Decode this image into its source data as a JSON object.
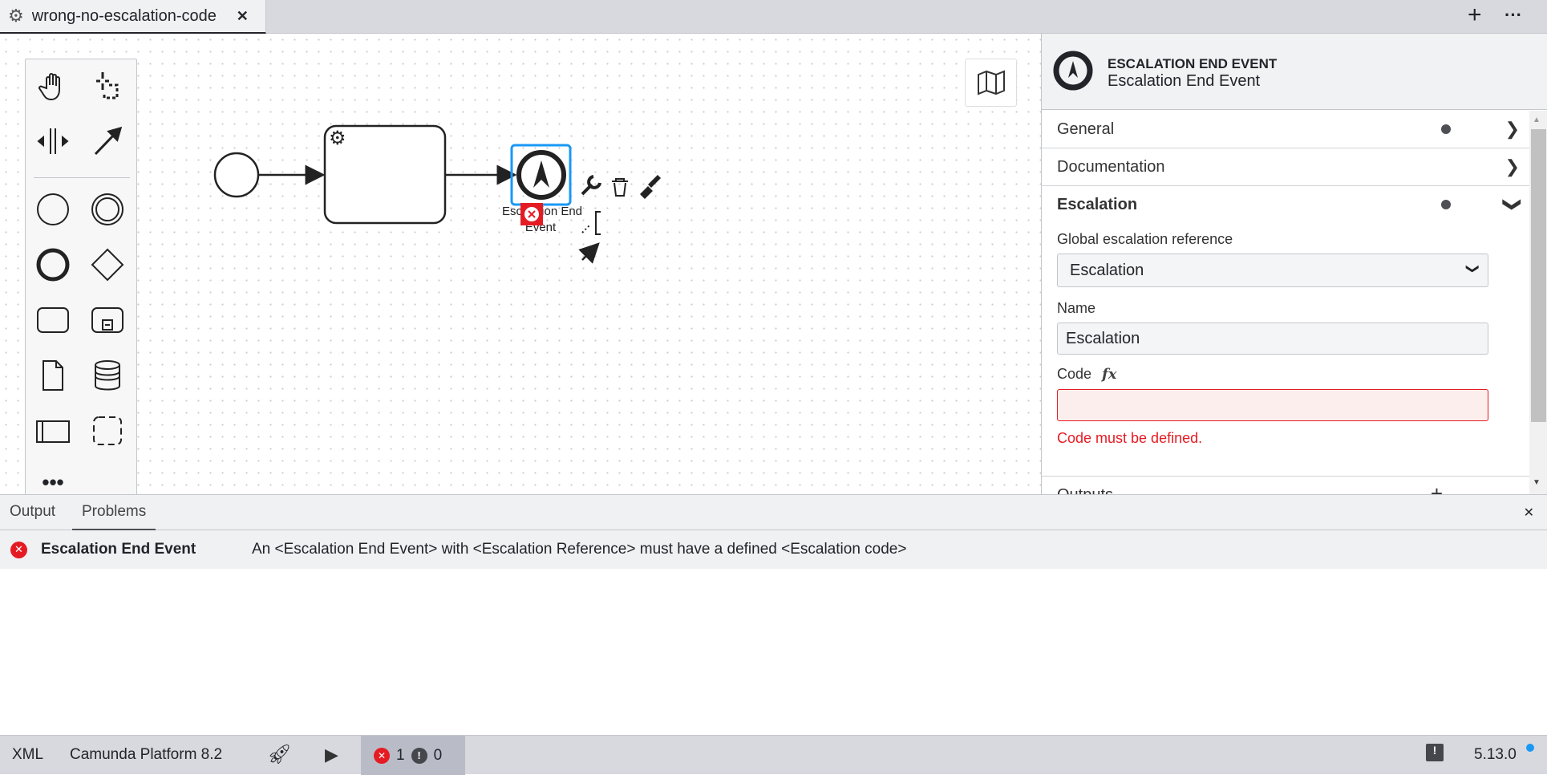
{
  "tab": {
    "title": "wrong-no-escalation-code",
    "icon": "gear-icon",
    "close": "✕"
  },
  "tabbar": {
    "add": "+",
    "more": "···"
  },
  "diagram": {
    "end_event_label_line1": "Escalation End",
    "end_event_label_line2": "Event",
    "selection_color": "#1a98f5",
    "error_color": "#e51b24"
  },
  "properties": {
    "type": "ESCALATION END EVENT",
    "name": "Escalation End Event",
    "sections": [
      {
        "label": "General",
        "has_dot": true
      },
      {
        "label": "Documentation",
        "has_dot": false
      },
      {
        "label": "Escalation",
        "has_dot": true,
        "expanded": true
      },
      {
        "label": "Outputs"
      }
    ],
    "global_ref_label": "Global escalation reference",
    "global_ref_value": "Escalation",
    "name_label": "Name",
    "name_value": "Escalation",
    "code_label": "Code",
    "code_fx": "fx",
    "code_value": "",
    "code_error": "Code must be defined."
  },
  "bottom": {
    "tabs": [
      "Output",
      "Problems"
    ],
    "active_tab": "Problems",
    "close": "✕",
    "problems": [
      {
        "element": "Escalation End Event",
        "message": "An <Escalation End Event> with <Escalation Reference> must have a defined <Escalation code>"
      }
    ]
  },
  "status": {
    "xml": "XML",
    "platform": "Camunda Platform 8.2",
    "errors": "1",
    "warnings": "0",
    "version": "5.13.0"
  }
}
